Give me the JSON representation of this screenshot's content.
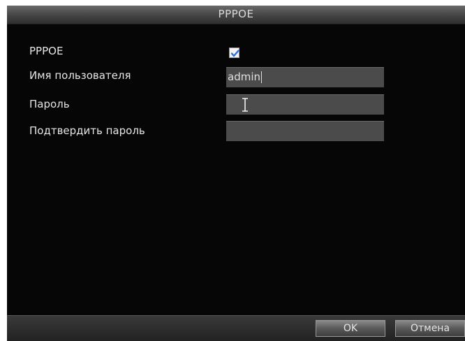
{
  "dialog": {
    "title": "PPPOE"
  },
  "form": {
    "pppoe_label": "PPPOE",
    "pppoe_enabled": true,
    "username_label": "Имя пользователя",
    "username_value": "admin",
    "password_label": "Пароль",
    "password_value": "",
    "confirm_label": "Подтвердить пароль",
    "confirm_value": ""
  },
  "buttons": {
    "ok_label": "OK",
    "cancel_label": "Отмена"
  },
  "colors": {
    "background": "#060606",
    "field": "#4b4b4b",
    "checkmark": "#2f6fd6"
  },
  "icons": {
    "checkbox": "checkmark-icon",
    "cursor": "text-cursor-icon"
  }
}
